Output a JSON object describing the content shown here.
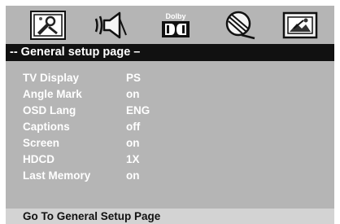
{
  "icons": [
    {
      "name": "general-setup-icon",
      "label": ""
    },
    {
      "name": "audio-speaker-icon",
      "label": ""
    },
    {
      "name": "dolby-icon",
      "label": "Dolby"
    },
    {
      "name": "video-reel-icon",
      "label": ""
    },
    {
      "name": "preference-icon",
      "label": ""
    }
  ],
  "header": {
    "title": "-- General setup page –"
  },
  "settings": [
    {
      "label": "TV Display",
      "value": "PS"
    },
    {
      "label": "Angle Mark",
      "value": "on"
    },
    {
      "label": "OSD Lang",
      "value": "ENG"
    },
    {
      "label": "Captions",
      "value": "off"
    },
    {
      "label": "Screen",
      "value": "on"
    },
    {
      "label": "HDCD",
      "value": "1X"
    },
    {
      "label": "Last Memory",
      "value": "on"
    }
  ],
  "footer": {
    "text": "Go To General Setup Page"
  },
  "colors": {
    "panel": "#b5b5b5",
    "titlebar": "#111111",
    "text": "#ffffff",
    "footer_bg": "#d3d3d3"
  }
}
